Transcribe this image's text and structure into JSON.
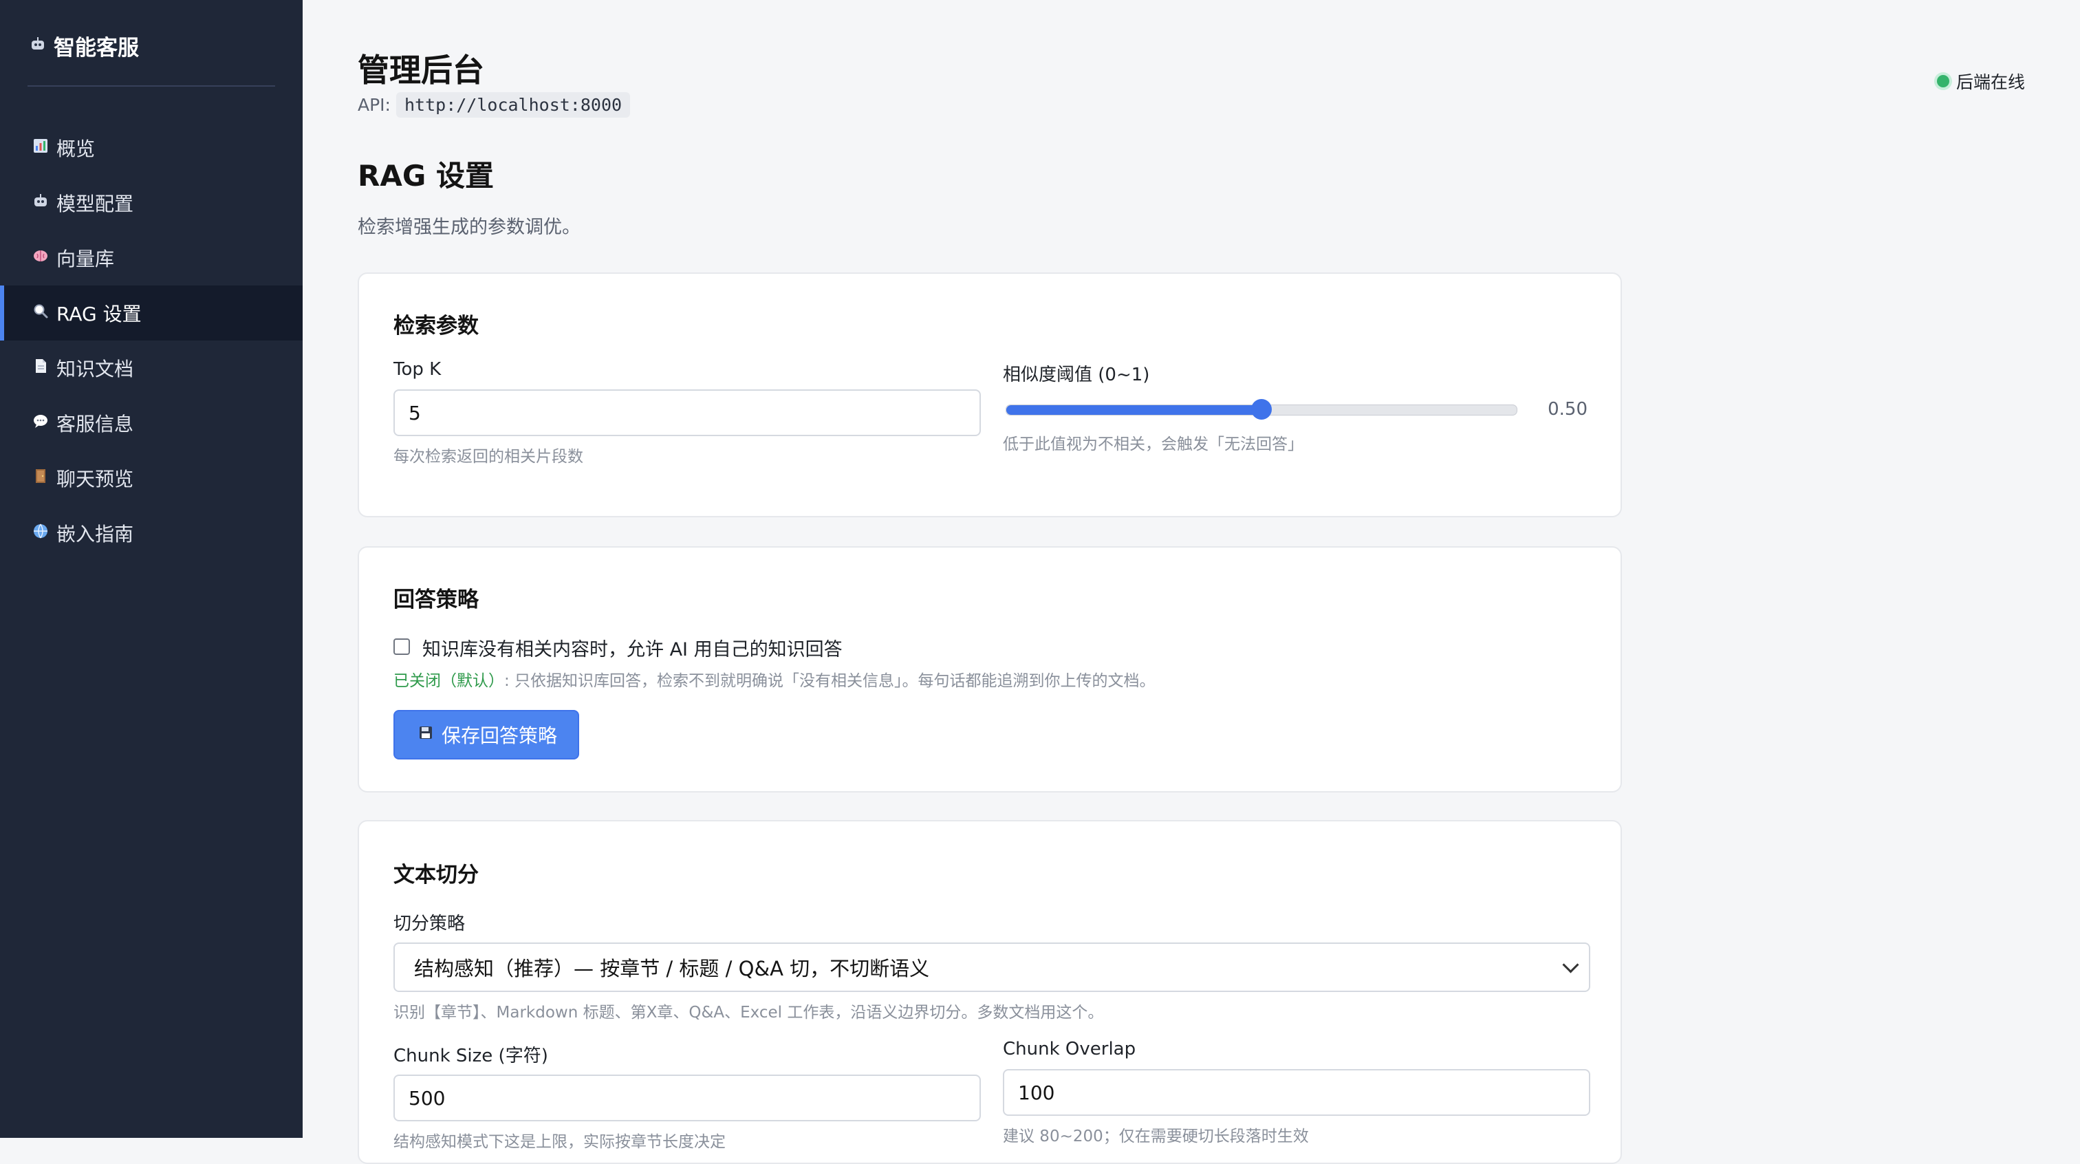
{
  "sidebar": {
    "brand": {
      "icon": "robot-icon",
      "title": "智能客服"
    },
    "items": [
      {
        "icon": "chart-icon",
        "label": "概览",
        "active": false
      },
      {
        "icon": "robot-icon",
        "label": "模型配置",
        "active": false
      },
      {
        "icon": "brain-icon",
        "label": "向量库",
        "active": false
      },
      {
        "icon": "magnifier-icon",
        "label": "RAG 设置",
        "active": true
      },
      {
        "icon": "document-icon",
        "label": "知识文档",
        "active": false
      },
      {
        "icon": "speech-bubble-icon",
        "label": "客服信息",
        "active": false
      },
      {
        "icon": "door-icon",
        "label": "聊天预览",
        "active": false
      },
      {
        "icon": "globe-icon",
        "label": "嵌入指南",
        "active": false
      }
    ]
  },
  "header": {
    "title": "管理后台",
    "api_label": "API:",
    "api_url": "http://localhost:8000",
    "status_label": "后端在线",
    "status_color": "#34b36b"
  },
  "page": {
    "title": "RAG 设置",
    "description": "检索增强生成的参数调优。"
  },
  "retrieval": {
    "title": "检索参数",
    "topk_label": "Top K",
    "topk_value": "5",
    "topk_hint": "每次检索返回的相关片段数",
    "threshold_label": "相似度阈值 (0~1)",
    "threshold_value": 0.5,
    "threshold_display": "0.50",
    "threshold_hint": "低于此值视为不相关，会触发「无法回答」"
  },
  "answer": {
    "title": "回答策略",
    "checkbox_label": "知识库没有相关内容时，允许 AI 用自己的知识回答",
    "checkbox_checked": false,
    "status_prefix": "已关闭（默认）",
    "status_text": ": 只依据知识库回答，检索不到就明确说「没有相关信息」。每句话都能追溯到你上传的文档。",
    "save_button": "保存回答策略",
    "save_icon": "floppy-disk-icon"
  },
  "chunking": {
    "title": "文本切分",
    "strategy_label": "切分策略",
    "strategy_value": "结构感知（推荐）— 按章节 / 标题 / Q&A 切，不切断语义",
    "strategy_hint": "识别【章节】、Markdown 标题、第X章、Q&A、Excel 工作表，沿语义边界切分。多数文档用这个。",
    "size_label": "Chunk Size (字符)",
    "size_value": "500",
    "size_hint": "结构感知模式下这是上限，实际按章节长度决定",
    "overlap_label": "Chunk Overlap",
    "overlap_value": "100",
    "overlap_hint": "建议 80~200；仅在需要硬切长段落时生效"
  }
}
